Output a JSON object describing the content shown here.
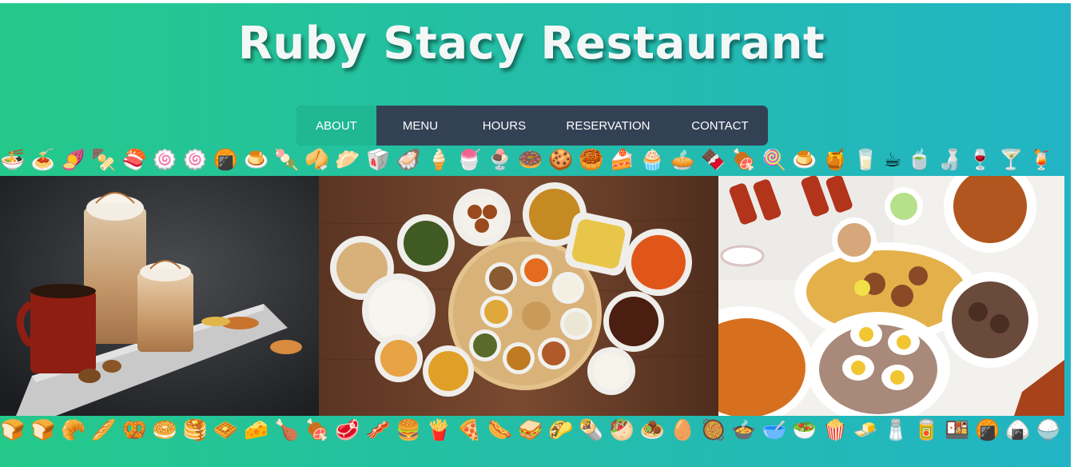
{
  "header": {
    "title": "Ruby Stacy Restaurant"
  },
  "nav": {
    "items": [
      {
        "label": "ABOUT",
        "active": true
      },
      {
        "label": "MENU",
        "active": false
      },
      {
        "label": "HOURS",
        "active": false
      },
      {
        "label": "RESERVATION",
        "active": false
      },
      {
        "label": "CONTACT",
        "active": false
      }
    ]
  },
  "top_strip": "🍜🍝🍠🍢🍣🍥🍥🍘🍮🍡🥠🥟🥡🦪🍦🍧🍨🍩🍪🥮🍰🧁🥧🍫🍖🍭🍮🍯🥛☕🍵🍶🍷🍸🍹",
  "bottom_strip": "🍞🍞🥐🥖🥨🥯🥞🧇🧀🍗🍖🥩🥓🍔🍟🍕🌭🥪🌮🌯🥙🧆🥚🥘🍲🥣🥗🍿🧈🧂🥫🍱🍘🍙🍚",
  "colors": {
    "background_start": "#24c98a",
    "background_end": "#22b4c4",
    "nav_bg": "#334155",
    "nav_active": "#1fb893"
  },
  "photos": [
    {
      "name": "coffee-drinks-photo"
    },
    {
      "name": "indian-thali-photo"
    },
    {
      "name": "biryani-feast-photo"
    }
  ]
}
